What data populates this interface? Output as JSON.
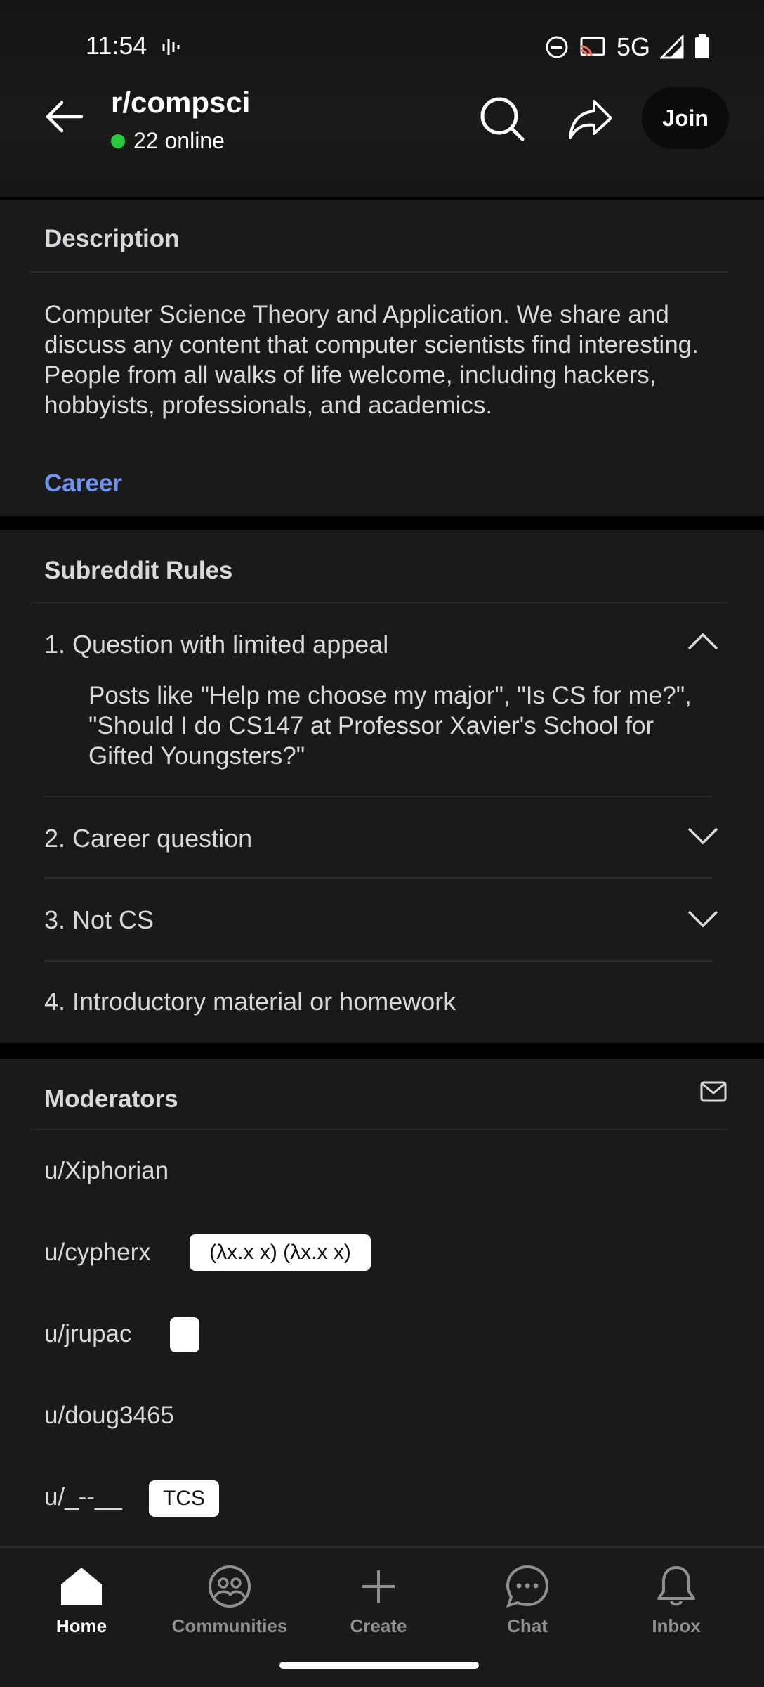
{
  "status_bar": {
    "time": "11:54",
    "network": "5G"
  },
  "header": {
    "subreddit": "r/compsci",
    "online": "22 online",
    "join_label": "Join"
  },
  "description": {
    "heading": "Description",
    "text": "Computer Science Theory and Application. We share and discuss any content that computer scientists find interesting. People from all walks of life welcome, including hackers, hobbyists, professionals, and academics.",
    "link": "Career"
  },
  "rules": {
    "heading": "Subreddit Rules",
    "items": [
      {
        "title": "1. Question with limited appeal",
        "expanded": true,
        "body": "Posts like \"Help me choose my major\", \"Is CS for me?\", \"Should I do CS147 at Professor Xavier's School for Gifted Youngsters?\""
      },
      {
        "title": "2. Career question",
        "expanded": false
      },
      {
        "title": "3. Not CS",
        "expanded": false
      },
      {
        "title": "4. Introductory material or homework",
        "expanded": false
      }
    ]
  },
  "moderators": {
    "heading": "Moderators",
    "items": [
      {
        "name": "u/Xiphorian",
        "flair": ""
      },
      {
        "name": "u/cypherx",
        "flair": "(λx.x x) (λx.x x)"
      },
      {
        "name": "u/jrupac",
        "flair": ""
      },
      {
        "name": "u/doug3465",
        "flair": ""
      },
      {
        "name": "u/_--__",
        "flair": "TCS"
      }
    ]
  },
  "bottom_nav": [
    {
      "label": "Home",
      "icon": "home-icon",
      "active": true
    },
    {
      "label": "Communities",
      "icon": "communities-icon",
      "active": false
    },
    {
      "label": "Create",
      "icon": "plus-icon",
      "active": false
    },
    {
      "label": "Chat",
      "icon": "chat-icon",
      "active": false
    },
    {
      "label": "Inbox",
      "icon": "bell-icon",
      "active": false
    }
  ],
  "colors": {
    "accent_link": "#6f93ef",
    "online_dot": "#27c93f",
    "card_bg": "#1a1a1b"
  }
}
